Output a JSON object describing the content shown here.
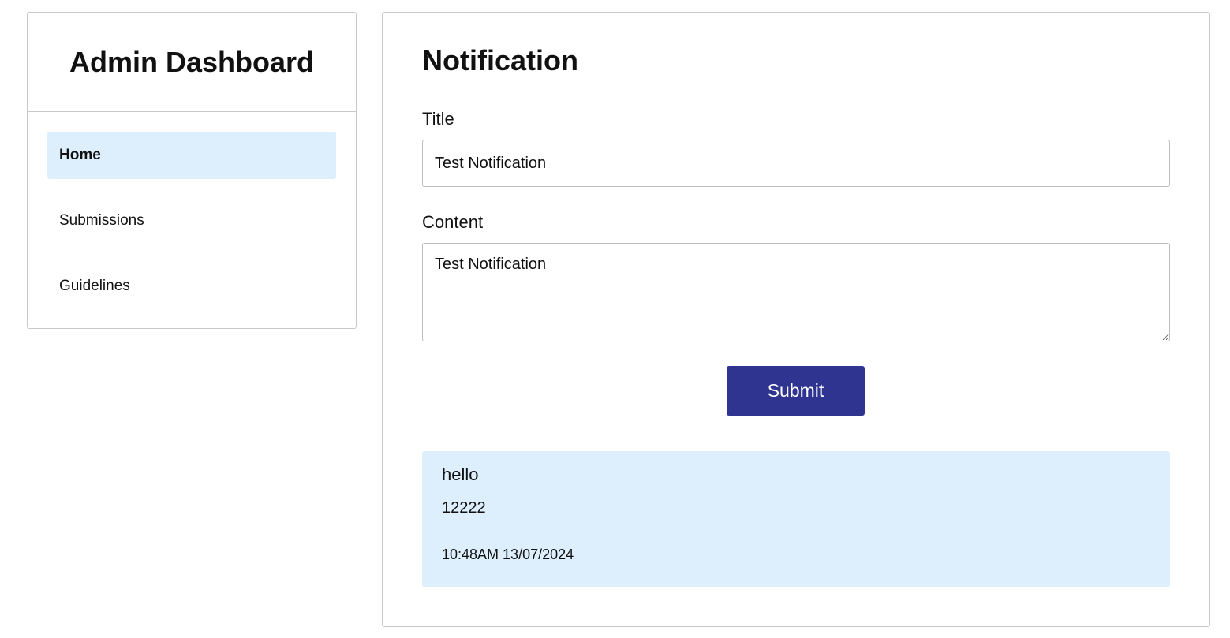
{
  "sidebar": {
    "title": "Admin Dashboard",
    "items": [
      {
        "label": "Home",
        "active": true
      },
      {
        "label": "Submissions",
        "active": false
      },
      {
        "label": "Guidelines",
        "active": false
      }
    ]
  },
  "main": {
    "title": "Notification",
    "form": {
      "title_label": "Title",
      "title_value": "Test Notification",
      "content_label": "Content",
      "content_value": "Test Notification",
      "submit_label": "Submit"
    },
    "notifications": [
      {
        "title": "hello",
        "content": "12222",
        "time": "10:48AM 13/07/2024"
      }
    ]
  },
  "colors": {
    "accent": "#2e348f",
    "highlight": "#ddeefd",
    "border": "#c8c8c8"
  }
}
